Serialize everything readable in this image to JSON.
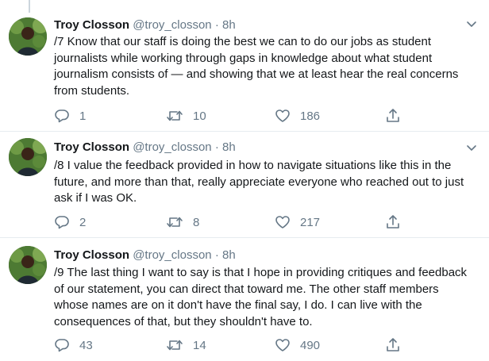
{
  "tweets": [
    {
      "name": "Troy Closson",
      "handle": "@troy_closson",
      "separator": "·",
      "time": "8h",
      "text": "/7 Know that our staff is doing the best we can to do our jobs as student journalists while working through gaps in knowledge about what student journalism consists of — and showing that we at least hear the real concerns from students.",
      "replies": "1",
      "retweets": "10",
      "likes": "186"
    },
    {
      "name": "Troy Closson",
      "handle": "@troy_closson",
      "separator": "·",
      "time": "8h",
      "text": "/8 I value the feedback provided in how to navigate situations like this in the future, and more than that, really appreciate everyone who reached out to just ask if I was OK.",
      "replies": "2",
      "retweets": "8",
      "likes": "217"
    },
    {
      "name": "Troy Closson",
      "handle": "@troy_closson",
      "separator": "·",
      "time": "8h",
      "text": "/9 The last thing I want to say is that I hope in providing critiques and feedback of our statement, you can direct that toward me. The other staff members whose names are on it don't have the final say, I do. I can live with the consequences of that, but they shouldn't have to.",
      "replies": "43",
      "retweets": "14",
      "likes": "490"
    }
  ],
  "icons": {
    "reply": "reply-icon",
    "retweet": "retweet-icon",
    "like": "heart-icon",
    "share": "share-icon",
    "more": "chevron-down-icon"
  },
  "colors": {
    "text": "#14171a",
    "muted": "#657786",
    "divider": "#e6ecf0"
  }
}
